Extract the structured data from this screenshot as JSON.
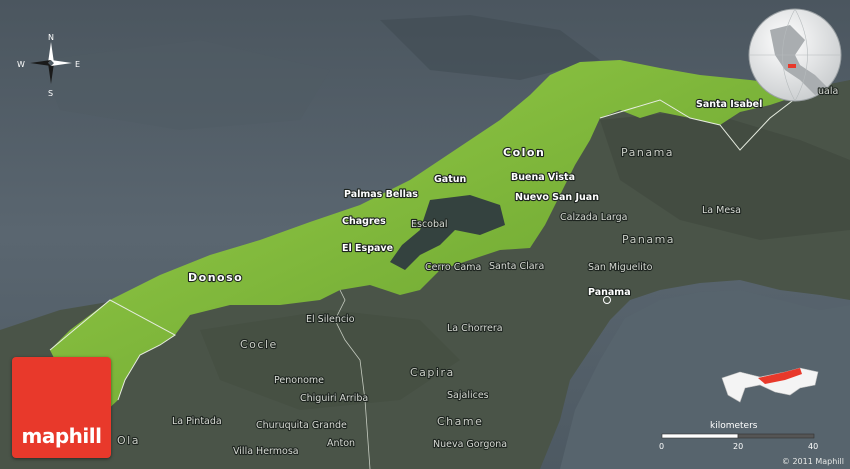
{
  "map": {
    "brand": "maphill",
    "copyright": "© 2011 Maphill",
    "compass": {
      "n": "N",
      "s": "S",
      "e": "E",
      "w": "W"
    },
    "scale": {
      "title": "kilometers",
      "ticks": [
        "0",
        "20",
        "40"
      ]
    },
    "regions": {
      "colon_highlight": "Colon",
      "donoso": "Donoso",
      "panama_1": "Panama",
      "panama_2": "Panama",
      "cocle": "Cocle",
      "capira": "Capira",
      "chame": "Chame",
      "ola": "Ola"
    },
    "places_highlight": {
      "santa_isabel": "Santa Isabel",
      "palmas_bellas": "Palmas Bellas",
      "gatun": "Gatun",
      "buena_vista": "Buena Vista",
      "nuevo_san_juan": "Nuevo San Juan",
      "chagres": "Chagres",
      "el_espave": "El Espave"
    },
    "places": {
      "escobal": "Escobal",
      "calzada_larga": "Calzada Larga",
      "la_mesa": "La Mesa",
      "cerro_cama": "Cerro Cama",
      "santa_clara": "Santa Clara",
      "san_miguelito": "San Miguelito",
      "panama_city": "Panama",
      "el_silencio": "El Silencio",
      "la_chorrera": "La Chorrera",
      "penonome": "Penonome",
      "chiguiri_arriba": "Chiguiri Arriba",
      "sajalices": "Sajalices",
      "la_pintada": "La Pintada",
      "churuquita_grande": "Churuquita Grande",
      "anton": "Anton",
      "villa_hermosa": "Villa Hermosa",
      "nueva_gorgona": "Nueva Gorgona",
      "uala": "uala"
    },
    "colors": {
      "highlight_land": "#8cc63f",
      "land": "#4a5448",
      "sea": "#56636d",
      "brand_red": "#e8392b"
    }
  }
}
